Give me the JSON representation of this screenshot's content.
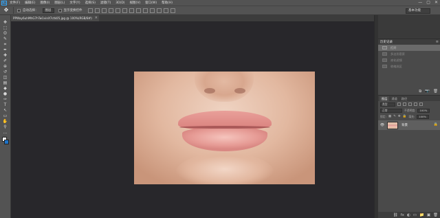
{
  "menubar": {
    "logo": "Ps",
    "items": [
      "文件(F)",
      "编辑(E)",
      "图像(I)",
      "图层(L)",
      "文字(Y)",
      "选择(S)",
      "滤镜(T)",
      "3D(D)",
      "视图(V)",
      "窗口(W)",
      "帮助(H)"
    ],
    "window_controls": [
      "—",
      "▢",
      "✕"
    ]
  },
  "options": {
    "auto_select_label": "自动选择：",
    "auto_select_target": "图层",
    "transform_label": "显示变换控件",
    "workspace": "基本功能"
  },
  "document_tab": {
    "title": "PPWay6uhMhG7hTw1vinX7ctk05.jpg @ 100%(RGB/8#)",
    "close": "×"
  },
  "tools": {
    "icons": [
      "move-icon",
      "marquee-icon",
      "lasso-icon",
      "quick-select-icon",
      "crop-icon",
      "eyedropper-icon",
      "healing-brush-icon",
      "brush-icon",
      "clone-stamp-icon",
      "history-brush-icon",
      "eraser-icon",
      "gradient-icon",
      "blur-icon",
      "dodge-icon",
      "pen-icon",
      "type-icon",
      "path-select-icon",
      "rectangle-icon",
      "hand-icon",
      "zoom-icon",
      "extra-tools-icon"
    ],
    "glyphs": [
      "✥",
      "⬚",
      "ʘ",
      "✎",
      "⌗",
      "✒",
      "✚",
      "✐",
      "⊕",
      "↺",
      "◫",
      "▤",
      "◆",
      "●",
      "✑",
      "T",
      "↖",
      "▭",
      "✋",
      "⚲",
      "…"
    ],
    "foreground_color": "#ffffff",
    "background_color": "#1e73c8"
  },
  "history_panel": {
    "title": "历史记录",
    "menu": "≡",
    "items": [
      {
        "label": "打开",
        "state": "active"
      },
      {
        "label": "多边形套索",
        "state": "dim"
      },
      {
        "label": "液化滤镜",
        "state": "dim"
      },
      {
        "label": "收缩选区",
        "state": "dim"
      }
    ],
    "footer_icons": [
      "⧉",
      "📷",
      "🗑"
    ]
  },
  "layers_panel": {
    "tabs": [
      "图层",
      "通道",
      "路径"
    ],
    "active_tab": "图层",
    "kind_label": "类型",
    "blend_mode": "正常",
    "opacity_label": "不透明度:",
    "opacity_value": "100%",
    "lock_label": "锁定:",
    "fill_label": "填充:",
    "fill_value": "100%",
    "layer": {
      "name": "背景",
      "visible_icon": "👁",
      "lock_icon": "🔒"
    },
    "footer_icons": [
      "⛓",
      "fx",
      "◐",
      "▭",
      "📁",
      "▣",
      "🗑"
    ]
  }
}
